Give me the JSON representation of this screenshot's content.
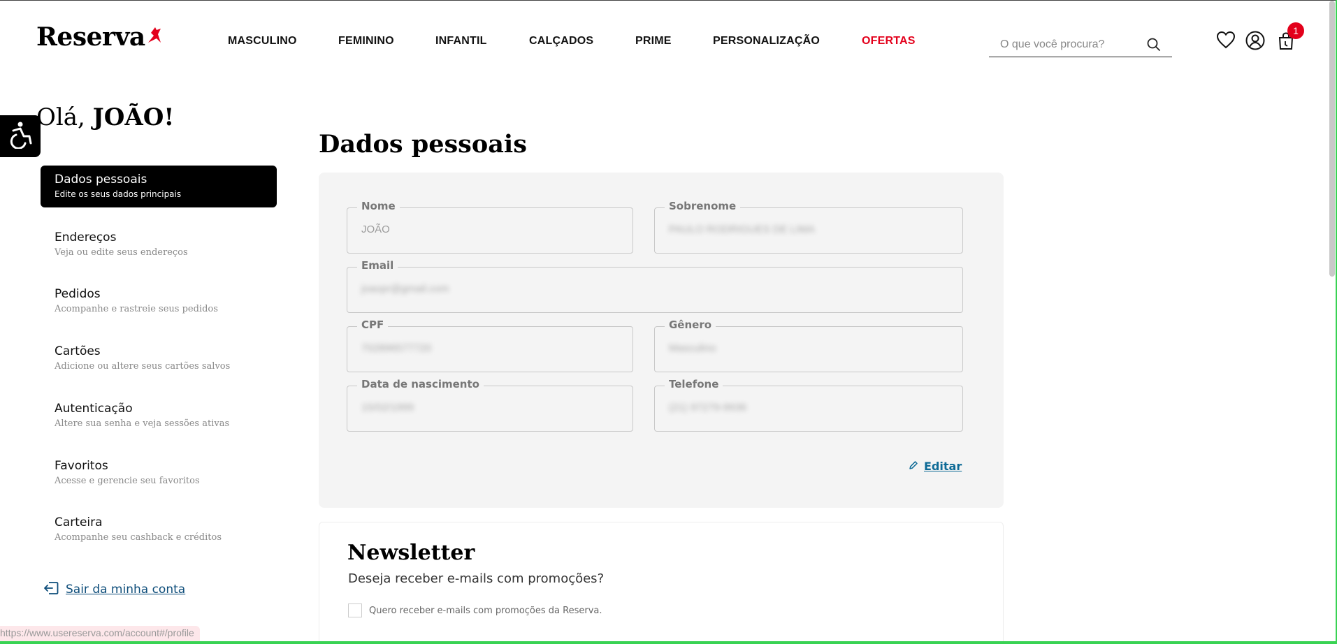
{
  "header": {
    "brand": "Reserva",
    "nav": [
      {
        "label": "MASCULINO"
      },
      {
        "label": "FEMININO"
      },
      {
        "label": "INFANTIL"
      },
      {
        "label": "CALÇADOS"
      },
      {
        "label": "PRIME"
      },
      {
        "label": "PERSONALIZAÇÃO"
      },
      {
        "label": "OFERTAS",
        "highlight_color": "#e3001b"
      }
    ],
    "search_placeholder": "O que você procura?",
    "cart_count": "1",
    "icons": [
      "heart-icon",
      "user-icon",
      "cart-icon",
      "search-icon"
    ]
  },
  "greeting": {
    "prefix": "Olá, ",
    "name": "JOÃO!"
  },
  "sidebar": {
    "items": [
      {
        "title": "Dados pessoais",
        "subtitle": "Edite os seus dados principais",
        "active": true
      },
      {
        "title": "Endereços",
        "subtitle": "Veja ou edite seus endereços"
      },
      {
        "title": "Pedidos",
        "subtitle": "Acompanhe e rastreie seus pedidos"
      },
      {
        "title": "Cartões",
        "subtitle": "Adicione ou altere seus cartões salvos"
      },
      {
        "title": "Autenticação",
        "subtitle": "Altere sua senha e veja sessões ativas"
      },
      {
        "title": "Favoritos",
        "subtitle": "Acesse e gerencie seu favoritos"
      },
      {
        "title": "Carteira",
        "subtitle": "Acompanhe seu cashback e créditos"
      }
    ],
    "logout": "Sair da minha conta"
  },
  "main": {
    "title": "Dados pessoais",
    "fields": {
      "nome": {
        "label": "Nome",
        "value": "JOÃO"
      },
      "sobrenome": {
        "label": "Sobrenome",
        "value": "PAULO RODRIGUES DE LIMA"
      },
      "email": {
        "label": "Email",
        "value": "joaopr@gmail.com"
      },
      "cpf": {
        "label": "CPF",
        "value": "702896577720"
      },
      "genero": {
        "label": "Gênero",
        "value": "Masculino"
      },
      "nascimento": {
        "label": "Data de nascimento",
        "value": "15/02/1999"
      },
      "telefone": {
        "label": "Telefone",
        "value": "(21) 97279-9936"
      }
    },
    "edit_label": "Editar"
  },
  "newsletter": {
    "title": "Newsletter",
    "subtitle": "Deseja receber e-mails com promoções?",
    "checkbox_label": "Quero receber e-mails com promoções da Reserva."
  },
  "status_bar": {
    "url": "https://www.usereserva.com/account#/profile"
  },
  "colors": {
    "accent_red": "#e3001b",
    "link_blue": "#0d6a96",
    "active_bg": "#000000"
  }
}
